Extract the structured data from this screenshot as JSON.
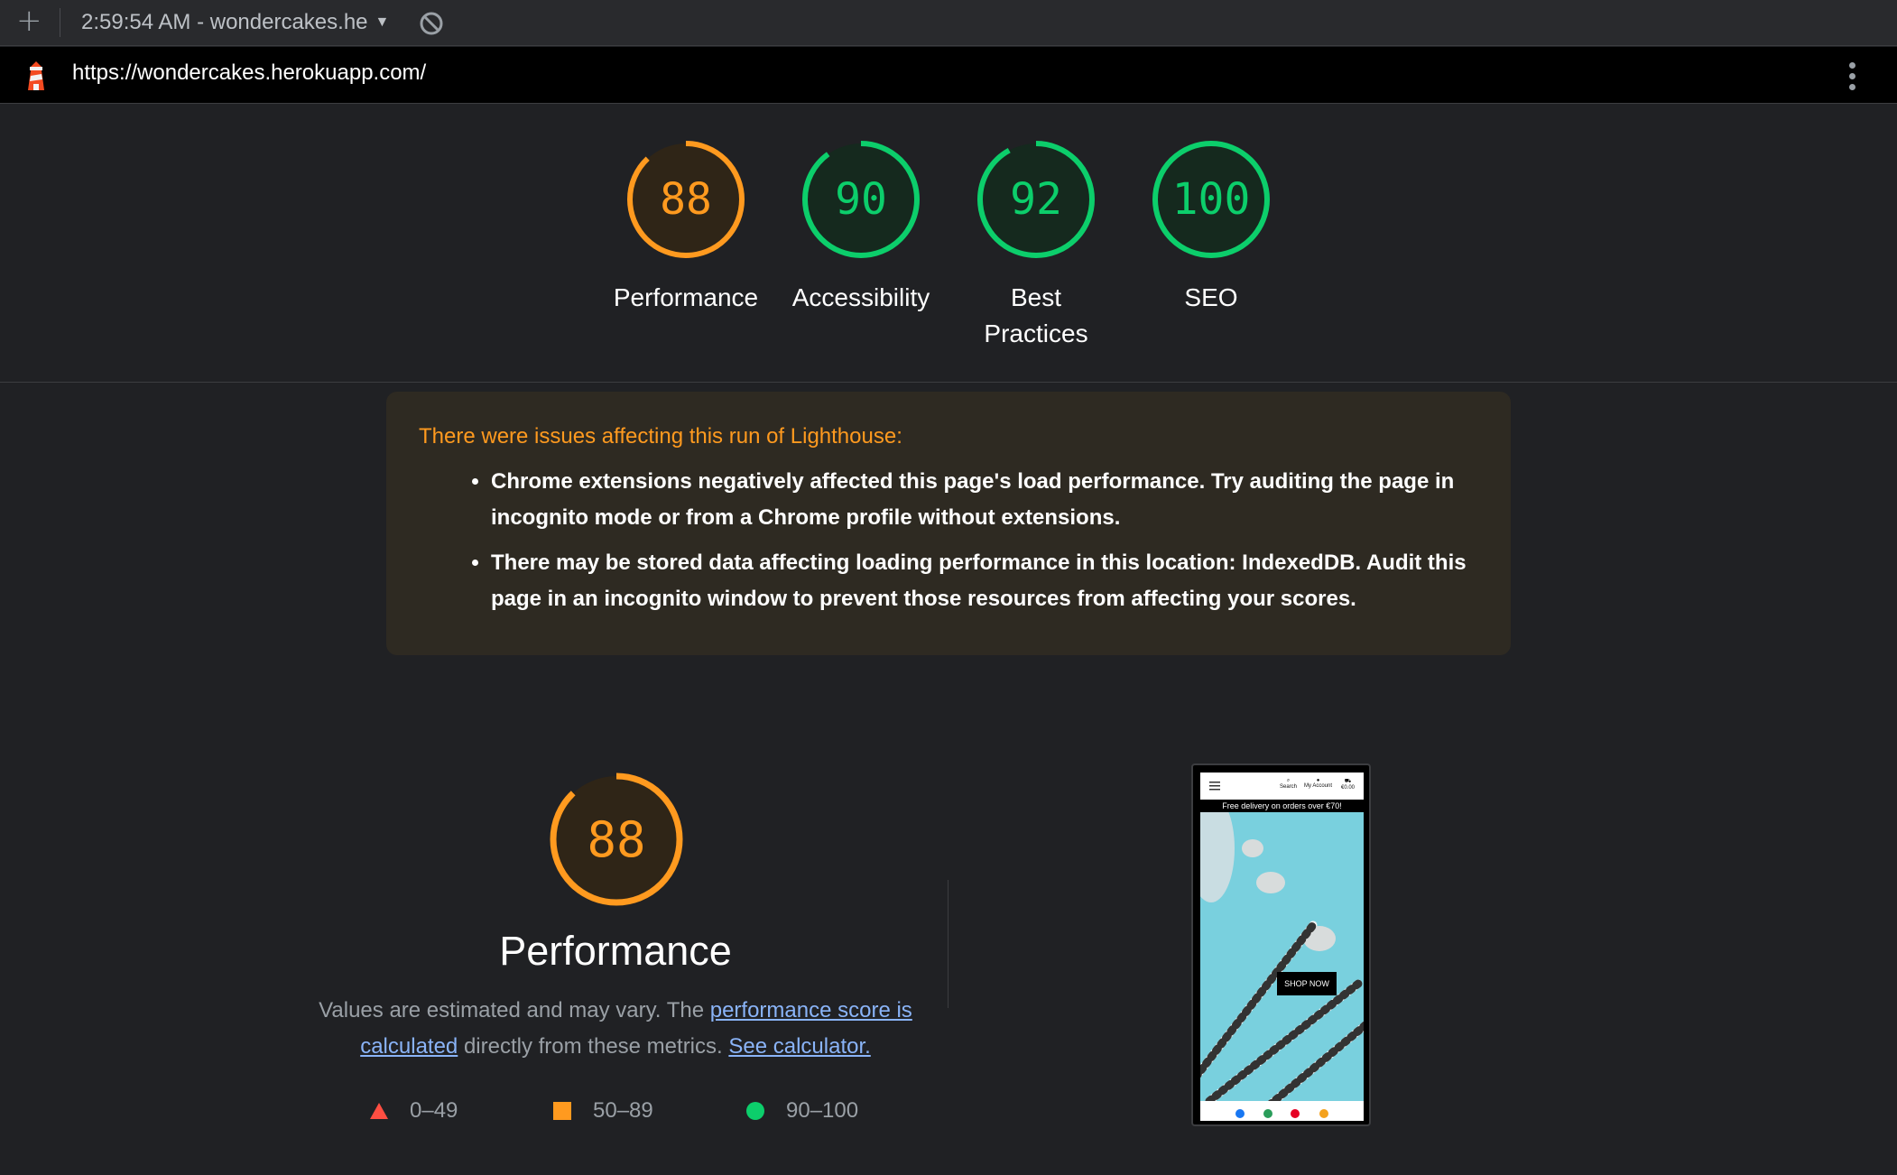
{
  "toolbar": {
    "new_report_icon": "plus-icon",
    "report_selector": "2:59:54 AM - wondercakes.he",
    "caret_icon": "caret-down-icon",
    "clear_icon": "block-icon"
  },
  "urlbar": {
    "logo_icon": "lighthouse-logo-icon",
    "url": "https://wondercakes.herokuapp.com/",
    "menu_icon": "kebab-menu-icon"
  },
  "colors": {
    "average": "#ff9a1f",
    "pass": "#0cce6b",
    "fail": "#ff4e42"
  },
  "scores": [
    {
      "label": "Performance",
      "value": 88,
      "status": "average"
    },
    {
      "label": "Accessibility",
      "value": 90,
      "status": "pass"
    },
    {
      "label": "Best Practices",
      "value": 92,
      "status": "pass"
    },
    {
      "label": "SEO",
      "value": 100,
      "status": "pass"
    }
  ],
  "warnings": {
    "title": "There were issues affecting this run of Lighthouse:",
    "items": [
      "Chrome extensions negatively affected this page's load performance. Try auditing the page in incognito mode or from a Chrome profile without extensions.",
      "There may be stored data affecting loading performance in this location: IndexedDB. Audit this page in an incognito window to prevent those resources from affecting your scores."
    ]
  },
  "performance": {
    "score": 88,
    "title": "Performance",
    "desc_prefix": "Values are estimated and may vary. The ",
    "desc_link1": "performance score is calculated",
    "desc_middle": " directly from these metrics. ",
    "desc_link2": "See calculator.",
    "legend": [
      {
        "range": "0–49",
        "shape": "triangle"
      },
      {
        "range": "50–89",
        "shape": "square"
      },
      {
        "range": "90–100",
        "shape": "circle"
      }
    ]
  },
  "thumbnail": {
    "nav_search": "Search",
    "nav_account": "My Account",
    "nav_cart": "€0.00",
    "banner": "Free delivery on orders over €70!",
    "cta": "SHOP NOW"
  }
}
